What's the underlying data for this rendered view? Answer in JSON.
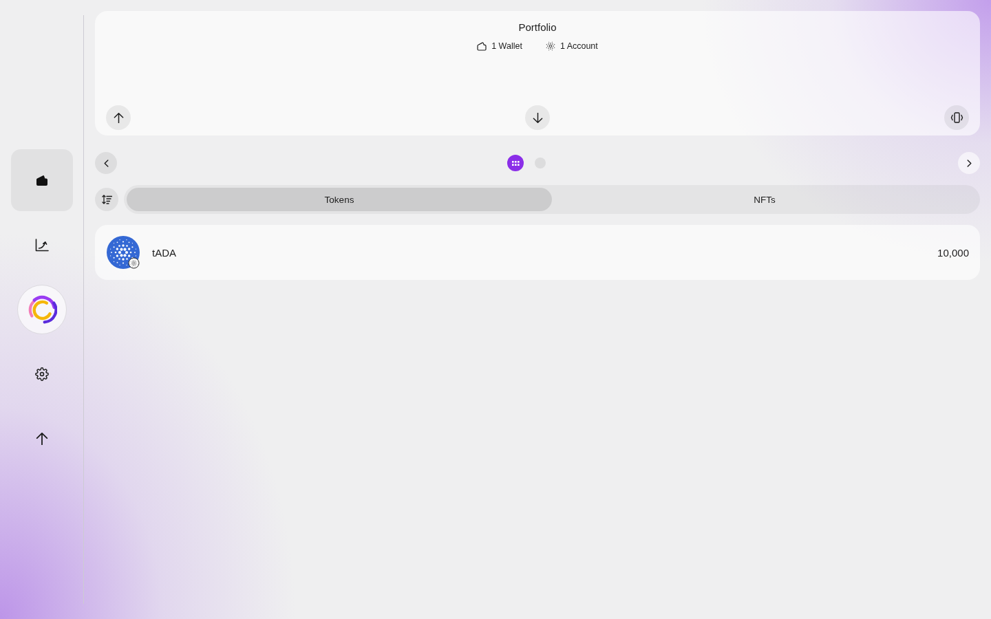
{
  "sidebar": {
    "items": [
      {
        "kind": "wallet",
        "selected": true
      },
      {
        "kind": "chart",
        "selected": false
      },
      {
        "kind": "logo",
        "selected": false
      },
      {
        "kind": "settings",
        "selected": false
      },
      {
        "kind": "send",
        "selected": false
      }
    ]
  },
  "portfolio": {
    "title": "Portfolio",
    "stats": [
      {
        "kind": "wallet",
        "label": "1 Wallet"
      },
      {
        "kind": "account",
        "label": "1 Account"
      }
    ]
  },
  "pager": {
    "back_disabled": true,
    "forward_disabled": false,
    "pages": [
      {
        "selected": true
      },
      {
        "selected": false
      }
    ]
  },
  "tabs": [
    {
      "label": "Tokens",
      "selected": true
    },
    {
      "label": "NFTs",
      "selected": false
    }
  ],
  "tokens": [
    {
      "name": "tADA",
      "amount": "10,000"
    }
  ]
}
